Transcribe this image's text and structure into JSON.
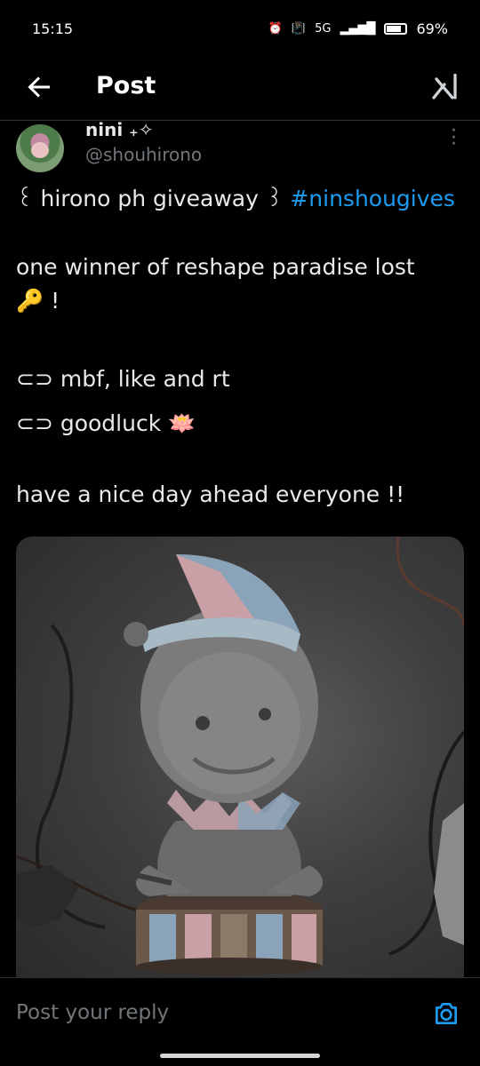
{
  "status_bar": {
    "time": "15:15",
    "network": "5G",
    "battery": "69%"
  },
  "header": {
    "title": "Post",
    "back_icon": "arrow-left-icon",
    "logo_icon": "grok-icon"
  },
  "post": {
    "author_name": "nini ₊✧",
    "author_handle": "@shouhirono",
    "lines": [
      {
        "text": "꒰ hirono ph giveaway ꒱ ",
        "hashtag": "#ninshougives"
      },
      {
        "text": "one winner of reshape paradise lost"
      },
      {
        "text": "🔑 !"
      },
      {
        "text": "⊂⊃ mbf, like and rt"
      },
      {
        "text": "⊂⊃ goodluck 🪷"
      },
      {
        "text": "have a nice day ahead everyone !!"
      }
    ]
  },
  "reply": {
    "placeholder": "Post your reply"
  }
}
